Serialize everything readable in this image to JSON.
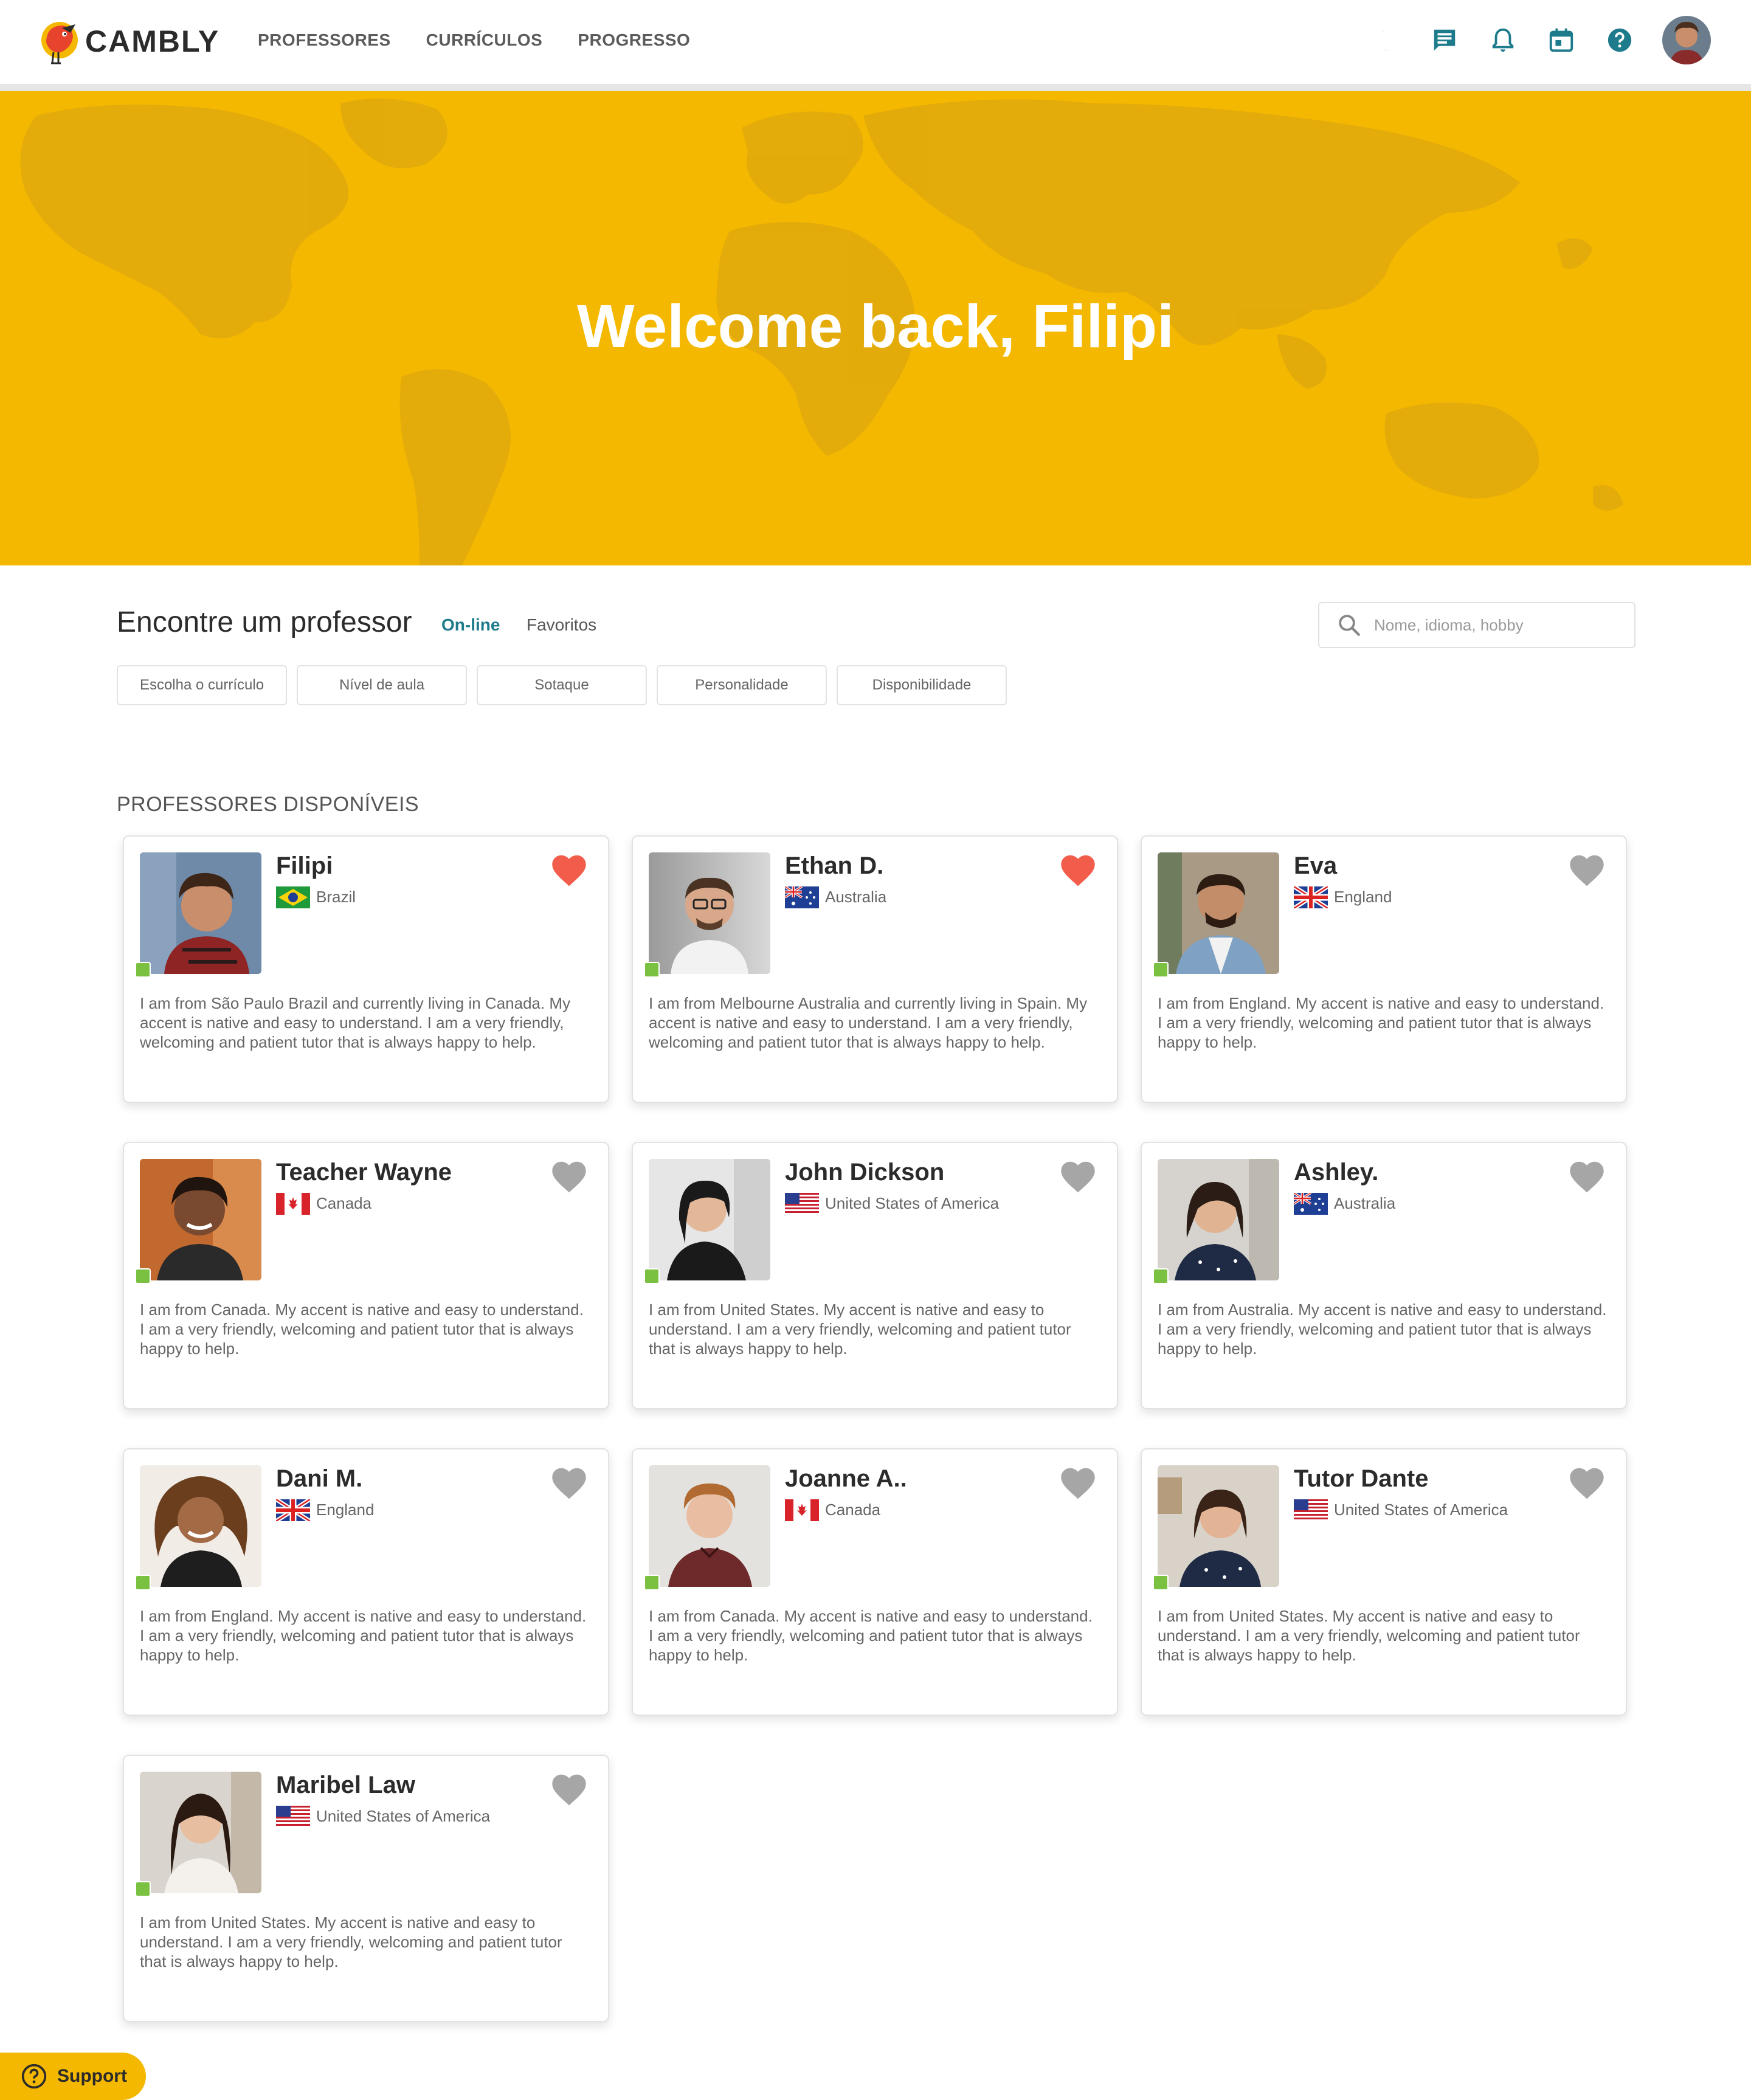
{
  "brand": {
    "name": "CAMBLY"
  },
  "nav": {
    "items": [
      "PROFESSORES",
      "CURRÍCULOS",
      "PROGRESSO"
    ]
  },
  "header_icons": [
    "moon-icon",
    "chat-icon",
    "bell-icon",
    "calendar-icon",
    "help-icon"
  ],
  "hero": {
    "title": "Welcome back, Filipi"
  },
  "finder": {
    "title": "Encontre um professor",
    "tab_online": "On-line",
    "tab_favorites": "Favoritos",
    "search_placeholder": "Nome, idioma, hobby",
    "filters": [
      "Escolha o currículo",
      "Nível de aula",
      "Sotaque",
      "Personalidade",
      "Disponibilidade"
    ]
  },
  "section": {
    "title": "PROFESSORES DISPONÍVEIS"
  },
  "teachers": [
    {
      "name": "Filipi",
      "country": "Brazil",
      "flag": "brazil",
      "favorite": true,
      "online": true,
      "bio": "I am from São Paulo Brazil and currently living in Canada. My accent is native and easy to understand. I am a very friendly, welcoming and patient tutor that is always happy to help."
    },
    {
      "name": "Ethan D.",
      "country": "Australia",
      "flag": "australia",
      "favorite": true,
      "online": true,
      "bio": "I am from Melbourne Australia and currently living in Spain. My accent is native and easy to understand. I am a very friendly, welcoming and patient tutor that is always happy to help."
    },
    {
      "name": "Eva",
      "country": "England",
      "flag": "uk",
      "favorite": false,
      "online": true,
      "bio": "I am from England. My accent is native and easy to understand. I am a very friendly, welcoming and patient tutor that is always happy to help."
    },
    {
      "name": "Teacher Wayne",
      "country": "Canada",
      "flag": "canada",
      "favorite": false,
      "online": true,
      "bio": "I am from Canada. My accent is native and easy to understand. I am a very friendly, welcoming and patient tutor that is always happy to help."
    },
    {
      "name": "John Dickson",
      "country": "United States of America",
      "flag": "usa",
      "favorite": false,
      "online": true,
      "bio": "I am from United States. My accent is native and easy to understand. I am a very friendly, welcoming and patient tutor that is always happy to help."
    },
    {
      "name": "Ashley.",
      "country": "Australia",
      "flag": "australia",
      "favorite": false,
      "online": true,
      "bio": "I am from Australia. My accent is native and easy to understand. I am a very friendly, welcoming and patient tutor that is always happy to help."
    },
    {
      "name": "Dani M.",
      "country": "England",
      "flag": "uk",
      "favorite": false,
      "online": true,
      "bio": "I am from England. My accent is native and easy to understand. I am a very friendly, welcoming and patient tutor that is always happy to help."
    },
    {
      "name": "Joanne A..",
      "country": "Canada",
      "flag": "canada",
      "favorite": false,
      "online": true,
      "bio": "I am from Canada. My accent is native and easy to understand. I am a very friendly, welcoming and patient tutor that is always happy to help."
    },
    {
      "name": "Tutor Dante",
      "country": "United States of America",
      "flag": "usa",
      "favorite": false,
      "online": true,
      "bio": "I am from United States. My accent is native and easy to understand. I am a very friendly, welcoming and patient tutor that is always happy to help."
    },
    {
      "name": "Maribel Law",
      "country": "United States of America",
      "flag": "usa",
      "favorite": false,
      "online": true,
      "bio": "I am from United States. My accent is native and easy to understand. I am a very friendly, welcoming and patient tutor that is always happy to help."
    }
  ],
  "support": {
    "label": "Support"
  },
  "colors": {
    "brand_yellow": "#f5b800",
    "accent_teal": "#1d7b8c",
    "favorite_red": "#f25c4a",
    "heart_gray": "#a6a6a6",
    "online_green": "#7ac142"
  }
}
